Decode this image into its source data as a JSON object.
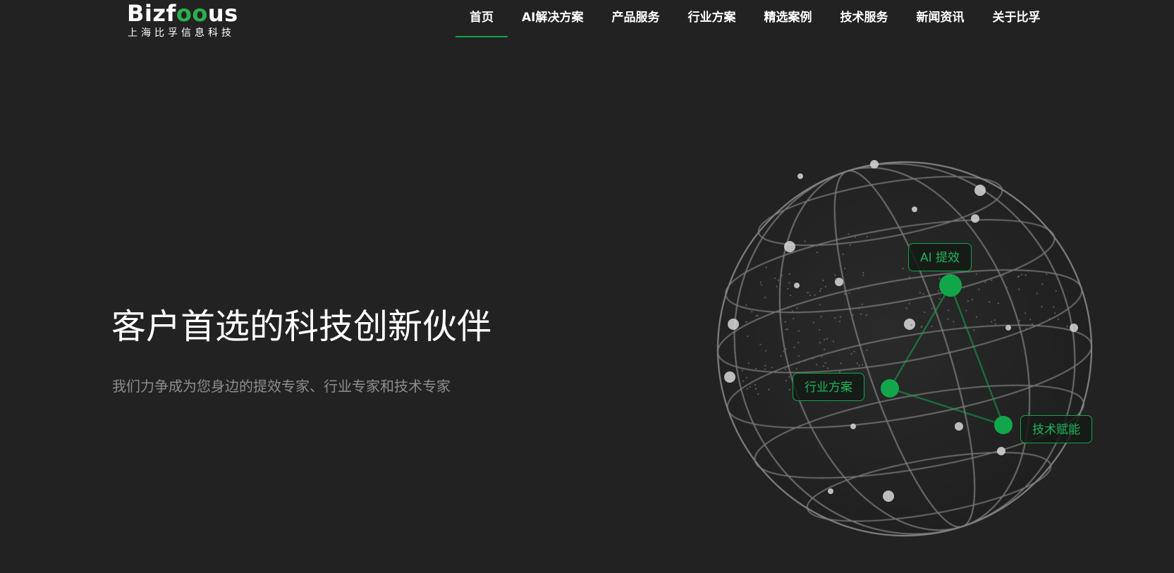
{
  "header": {
    "logo": {
      "word_left": "Bizf",
      "word_accent": "oo",
      "word_right": "us",
      "subtitle": "上海比孚信息科技"
    },
    "nav": [
      {
        "label": "首页",
        "active": true
      },
      {
        "label": "AI解决方案",
        "active": false
      },
      {
        "label": "产品服务",
        "active": false
      },
      {
        "label": "行业方案",
        "active": false
      },
      {
        "label": "精选案例",
        "active": false
      },
      {
        "label": "技术服务",
        "active": false
      },
      {
        "label": "新闻资讯",
        "active": false
      },
      {
        "label": "关于比孚",
        "active": false
      }
    ]
  },
  "hero": {
    "title": "客户首选的科技创新伙伴",
    "subtitle": "我们力争成为您身边的提效专家、行业专家和技术专家"
  },
  "globe": {
    "tags": {
      "ai": "AI 提效",
      "industry": "行业方案",
      "tech": "技术赋能"
    }
  },
  "colors": {
    "background": "#222222",
    "accent": "#12a64a",
    "subtitle_text": "#8d8d8d"
  },
  "icons": {
    "globe": "network-globe-icon"
  }
}
